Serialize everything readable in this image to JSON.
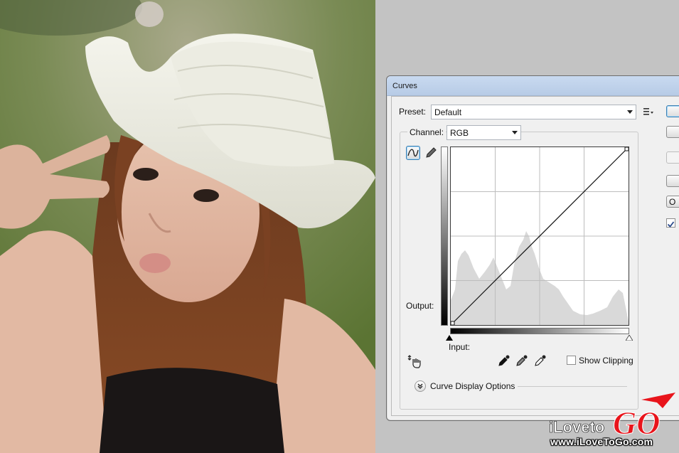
{
  "dialog": {
    "title": "Curves",
    "preset_label": "Preset:",
    "preset_value": "Default",
    "channel_label": "Channel:",
    "channel_value": "RGB",
    "output_label": "Output:",
    "input_label": "Input:",
    "show_clipping_label": "Show Clipping",
    "show_clipping_checked": false,
    "display_options_label": "Curve Display Options",
    "right_button_partial": "O",
    "preview_checked": true
  },
  "watermark": {
    "url": "www.iLoveToGo.com"
  },
  "colors": {
    "titlebar": "#b7cbe6",
    "histogram": "#d9d9d9",
    "accent_red": "#e8141b"
  },
  "icons": {
    "curve_tool": "curve-icon",
    "pencil_tool": "pencil-icon",
    "preset_options": "list-options-icon",
    "adjust_hand": "hand-adjust-icon",
    "eyedroppers": [
      "black-eyedropper-icon",
      "gray-eyedropper-icon",
      "white-eyedropper-icon"
    ],
    "expand": "chevron-double-down-icon"
  }
}
